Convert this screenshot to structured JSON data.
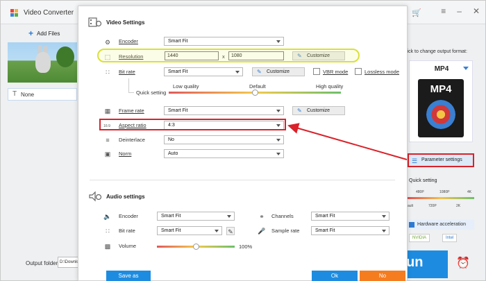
{
  "app": {
    "title": "Video Converter",
    "add_files": "Add Files",
    "subtitle_value": "None",
    "output_folder_label": "Output folder:",
    "output_path": "D:\\Downlo",
    "format_hint": "lick to change output format:",
    "format_name": "MP4",
    "format_icon_text": "MP4",
    "parameter_settings": "Parameter settings",
    "quick_setting": "Quick setting",
    "quick_ticks_top": [
      "480P",
      "1080P",
      "4K"
    ],
    "quick_ticks_bottom": [
      "ault",
      "720P",
      "2K"
    ],
    "hardware_acceleration": "Hardware acceleration",
    "nvidia": "NVIDIA",
    "intel": "Intel",
    "run": "un"
  },
  "dialog": {
    "video_title": "Video Settings",
    "encoder_label": "Encoder",
    "encoder_value": "Smart Fit",
    "resolution_label": "Resolution",
    "res_width": "1440",
    "res_x": "x",
    "res_height": "1080",
    "customize": "Customize",
    "bitrate_label": "Bit rate",
    "bitrate_value": "Smart Fit",
    "vbr_mode": "VBR mode",
    "lossless_mode": "Lossless mode",
    "quick_setting": "Quick setting",
    "low_quality": "Low quality",
    "default": "Default",
    "high_quality": "High quality",
    "quality_level": 0.5,
    "framerate_label": "Frame rate",
    "framerate_value": "Smart Fit",
    "aspect_label": "Aspect ratio",
    "aspect_value": "4:3",
    "aspect_icon_text": "16:9",
    "deinterlace_label": "Deinterlace",
    "deinterlace_value": "No",
    "norm_label": "Norm",
    "norm_value": "Auto",
    "audio_title": "Audio settings",
    "a_encoder_label": "Encoder",
    "a_encoder_value": "Smart Fit",
    "a_bitrate_label": "Bit rate",
    "a_bitrate_value": "Smart Fit",
    "channels_label": "Channels",
    "channels_value": "Smart Fit",
    "samplerate_label": "Sample rate",
    "samplerate_value": "Smart Fit",
    "volume_label": "Volume",
    "volume_value": "100%",
    "volume_level": 0.5,
    "save_as": "Save as",
    "ok": "Ok",
    "no": "No"
  },
  "colors": {
    "accent_blue": "#1d8ce0",
    "annotation_red": "#d9222a",
    "annotation_yellow": "#d9e03a",
    "no_button": "#f57c1f"
  }
}
